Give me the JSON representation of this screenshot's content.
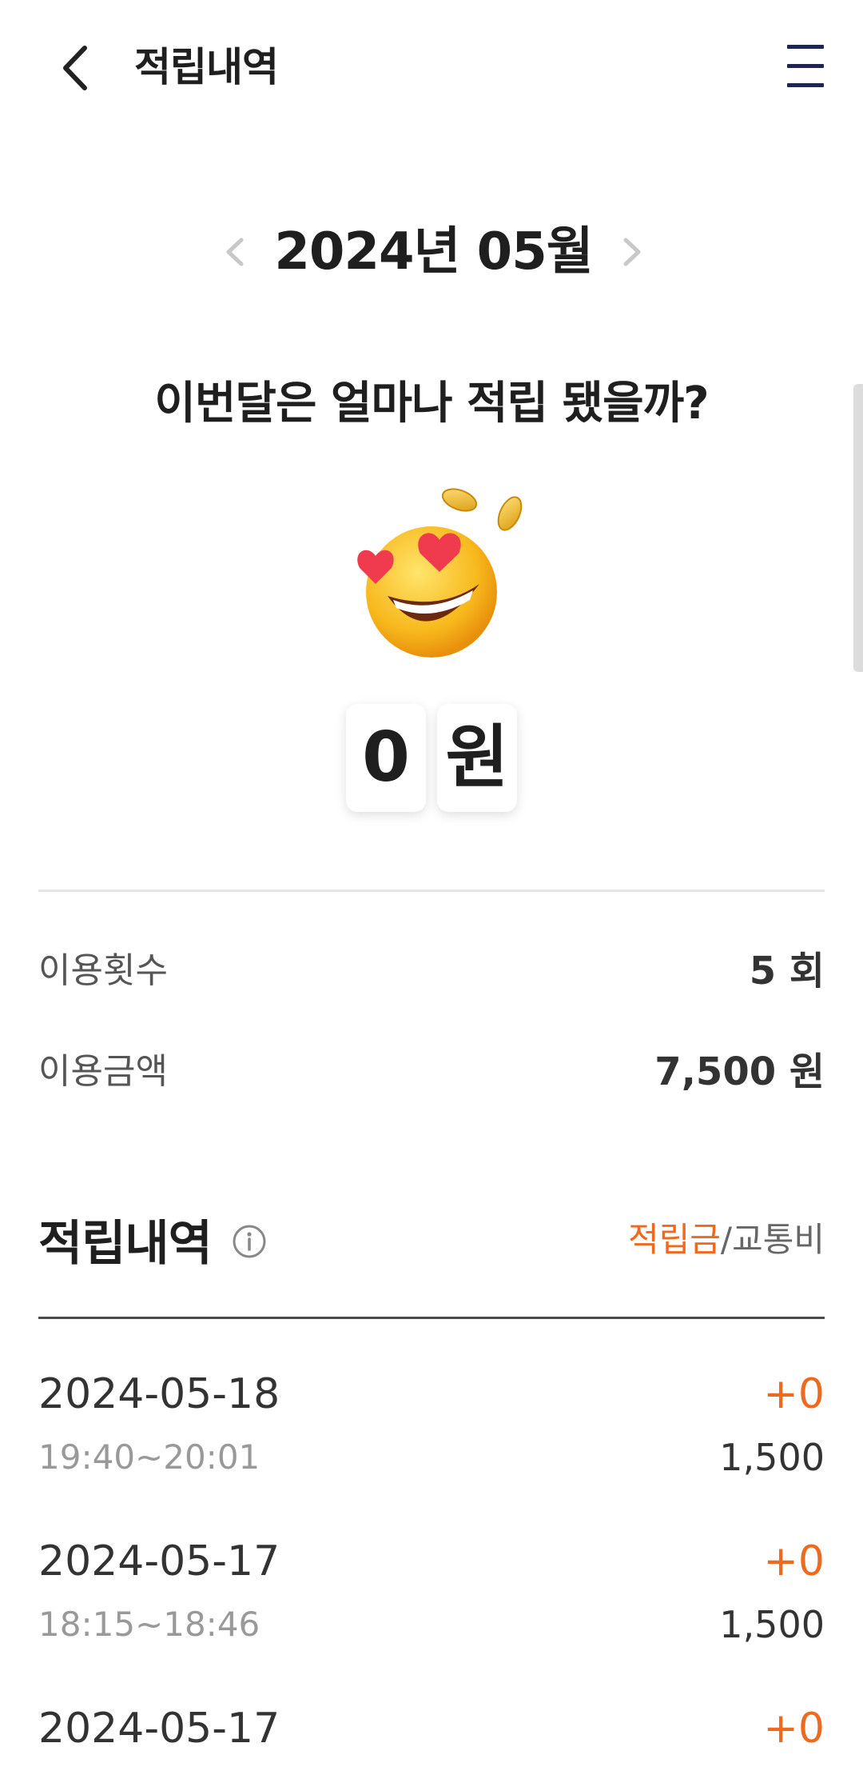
{
  "header": {
    "title": "적립내역",
    "back_icon": "chevron-left-icon",
    "menu_icon": "hamburger-menu-icon"
  },
  "month_nav": {
    "label": "2024년 05월",
    "prev_icon": "chevron-left-icon",
    "next_icon": "chevron-right-icon"
  },
  "summary": {
    "question": "이번달은 얼마나 적립 됐을까?",
    "emoji": "heart-eyes-face-with-coins",
    "amount_digit": "0",
    "amount_unit": "원"
  },
  "stats": [
    {
      "label": "이용횟수",
      "value": "5 회"
    },
    {
      "label": "이용금액",
      "value": "7,500 원"
    }
  ],
  "history": {
    "title": "적립내역",
    "info_icon": "info-icon",
    "filter_active": "적립금",
    "filter_separator": "/",
    "filter_inactive": "교통비",
    "rows": [
      {
        "date": "2024-05-18",
        "time": "19:40~20:01",
        "points": "+0",
        "fare": "1,500"
      },
      {
        "date": "2024-05-17",
        "time": "18:15~18:46",
        "points": "+0",
        "fare": "1,500"
      },
      {
        "date": "2024-05-17",
        "time": "",
        "points": "+0",
        "fare": ""
      }
    ]
  },
  "colors": {
    "accent": "#ef6a1f",
    "menu_icon": "#1f2550",
    "text_primary": "#1f1f1f",
    "text_secondary": "#999999"
  }
}
